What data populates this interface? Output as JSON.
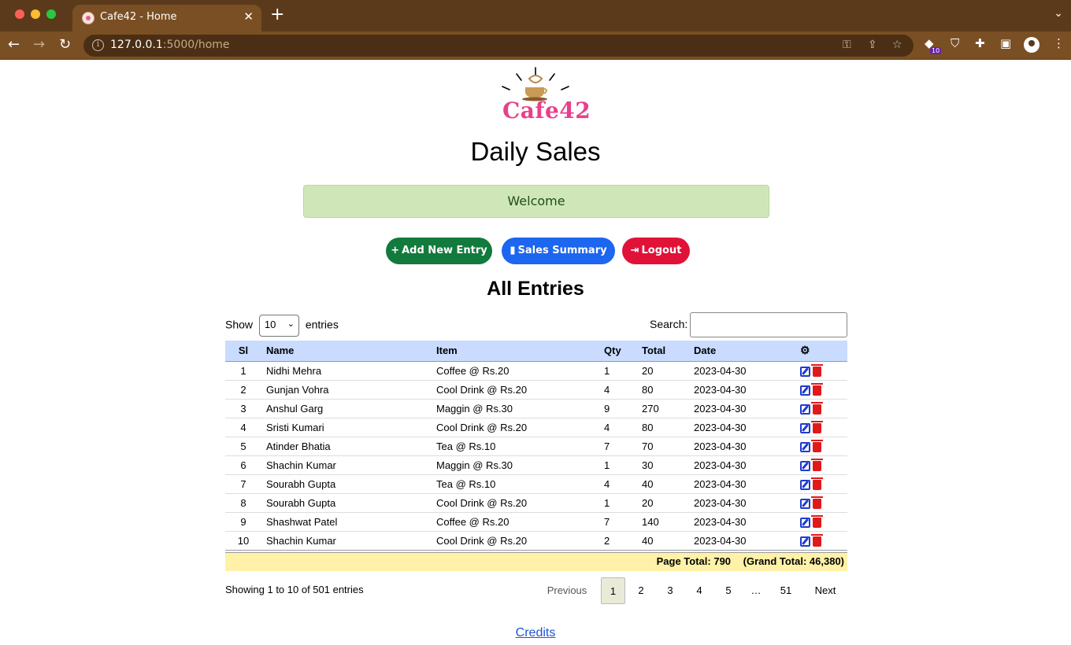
{
  "browser": {
    "tab_title": "Cafe42 - Home",
    "url_host": "127.0.0.1",
    "url_rest": ":5000/home",
    "extension_badge": "10"
  },
  "page": {
    "logo_text": "Cafe42",
    "title": "Daily Sales",
    "alert": "Welcome",
    "buttons": {
      "add": "Add New Entry",
      "summary": "Sales Summary",
      "logout": "Logout"
    },
    "section_title": "All Entries",
    "length": {
      "prefix": "Show",
      "value": "10",
      "suffix": "entries"
    },
    "search_label": "Search:",
    "table": {
      "columns": [
        "Sl",
        "Name",
        "Item",
        "Qty",
        "Total",
        "Date"
      ],
      "rows": [
        [
          "1",
          "Nidhi Mehra",
          "Coffee @ Rs.20",
          "1",
          "20",
          "2023-04-30"
        ],
        [
          "2",
          "Gunjan Vohra",
          "Cool Drink @ Rs.20",
          "4",
          "80",
          "2023-04-30"
        ],
        [
          "3",
          "Anshul Garg",
          "Maggin @ Rs.30",
          "9",
          "270",
          "2023-04-30"
        ],
        [
          "4",
          "Sristi Kumari",
          "Cool Drink @ Rs.20",
          "4",
          "80",
          "2023-04-30"
        ],
        [
          "5",
          "Atinder Bhatia",
          "Tea @ Rs.10",
          "7",
          "70",
          "2023-04-30"
        ],
        [
          "6",
          "Shachin Kumar",
          "Maggin @ Rs.30",
          "1",
          "30",
          "2023-04-30"
        ],
        [
          "7",
          "Sourabh Gupta",
          "Tea @ Rs.10",
          "4",
          "40",
          "2023-04-30"
        ],
        [
          "8",
          "Sourabh Gupta",
          "Cool Drink @ Rs.20",
          "1",
          "20",
          "2023-04-30"
        ],
        [
          "9",
          "Shashwat Patel",
          "Coffee @ Rs.20",
          "7",
          "140",
          "2023-04-30"
        ],
        [
          "10",
          "Shachin Kumar",
          "Cool Drink @ Rs.20",
          "2",
          "40",
          "2023-04-30"
        ]
      ]
    },
    "page_total": "Page Total: 790",
    "grand_total": "(Grand Total: 46,380)",
    "info": "Showing 1 to 10 of 501 entries",
    "pagination": {
      "previous": "Previous",
      "pages": [
        "1",
        "2",
        "3",
        "4",
        "5"
      ],
      "ellipsis": "…",
      "last": "51",
      "next": "Next",
      "current": "1"
    },
    "credits": "Credits"
  },
  "colors": {
    "chrome": "#7a4f24",
    "alert_bg": "#cfe7b8",
    "table_header_bg": "#c9dbff",
    "totals_bg": "#fff2a8",
    "add_button": "#127a3c",
    "summary_button": "#1c66f0",
    "logout_button": "#e01238"
  },
  "icons": [
    "plus-icon",
    "bar-chart-icon",
    "logout-icon",
    "gear-icon",
    "edit-icon",
    "trash-icon"
  ]
}
